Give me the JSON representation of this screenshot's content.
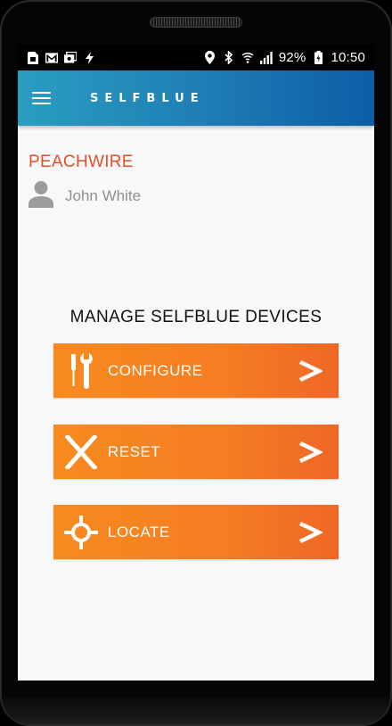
{
  "status": {
    "battery": "92%",
    "time": "10:50"
  },
  "appbar": {
    "brand": "SELFBLUE"
  },
  "account": {
    "organization": "PEACHWIRE",
    "user_name": "John White"
  },
  "main": {
    "title": "MANAGE SELFBLUE DEVICES",
    "actions": [
      {
        "label": "CONFIGURE",
        "icon": "tools-icon"
      },
      {
        "label": "RESET",
        "icon": "x-icon"
      },
      {
        "label": "LOCATE",
        "icon": "crosshair-icon"
      }
    ]
  },
  "colors": {
    "accent_orange": "#f78b1f",
    "appbar_blue": "#1f7fb6",
    "org_red": "#e2502a"
  }
}
